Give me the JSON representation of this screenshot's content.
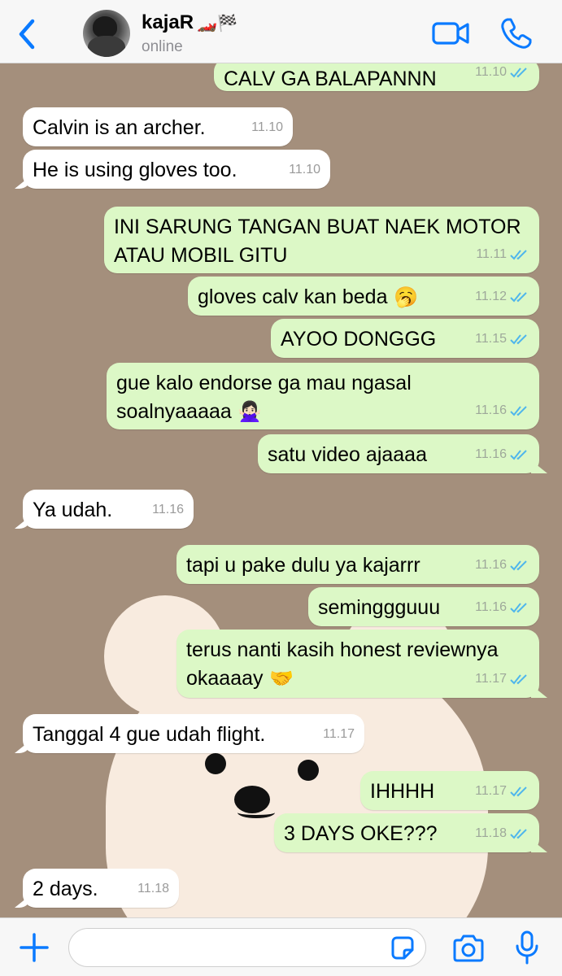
{
  "header": {
    "contact_name": "kajaR",
    "name_emoji": "🏎️🏁",
    "status": "online"
  },
  "colors": {
    "accent": "#0a7aff",
    "wallpaper": "#a48f7c",
    "incoming_bubble": "#ffffff",
    "outgoing_bubble": "#dcf8c6",
    "read_tick": "#4fb6ec"
  },
  "icons": {
    "back": "chevron-left-icon",
    "video": "video-camera-icon",
    "call": "phone-icon",
    "plus": "plus-icon",
    "sticker": "sticker-icon",
    "camera": "camera-icon",
    "mic": "microphone-icon",
    "read": "double-check-icon"
  },
  "messages": [
    {
      "dir": "out",
      "text": "CALV GA BALAPANNN",
      "time": "11.10"
    },
    {
      "dir": "in",
      "text": "Calvin is an archer.",
      "time": "11.10"
    },
    {
      "dir": "in",
      "text": "He is using gloves too.",
      "time": "11.10"
    },
    {
      "dir": "out",
      "text": "INI SARUNG TANGAN BUAT NAEK MOTOR\nATAU MOBIL GITU",
      "time": "11.11"
    },
    {
      "dir": "out",
      "text": "gloves calv kan beda",
      "emoji": "🥱",
      "time": "11.12"
    },
    {
      "dir": "out",
      "text": "AYOO DONGGG",
      "time": "11.15"
    },
    {
      "dir": "out",
      "text": "gue kalo endorse ga mau ngasal\nsoalnyaaaaa",
      "emoji": "🙅🏻‍♀️",
      "time": "11.16"
    },
    {
      "dir": "out",
      "text": "satu video ajaaaa",
      "time": "11.16"
    },
    {
      "dir": "in",
      "text": "Ya udah.",
      "time": "11.16"
    },
    {
      "dir": "out",
      "text": "tapi u pake dulu ya kajarrr",
      "time": "11.16"
    },
    {
      "dir": "out",
      "text": "seminggguuu",
      "time": "11.16"
    },
    {
      "dir": "out",
      "text": "terus nanti kasih honest reviewnya\nokaaaay",
      "emoji": "🤝",
      "time": "11.17"
    },
    {
      "dir": "in",
      "text": "Tanggal 4 gue udah flight.",
      "time": "11.17"
    },
    {
      "dir": "out",
      "text": "IHHHH",
      "time": "11.17"
    },
    {
      "dir": "out",
      "text": "3 DAYS OKE???",
      "time": "11.18"
    },
    {
      "dir": "in",
      "text": "2 days.",
      "time": "11.18"
    }
  ],
  "input": {
    "value": "",
    "placeholder": ""
  }
}
